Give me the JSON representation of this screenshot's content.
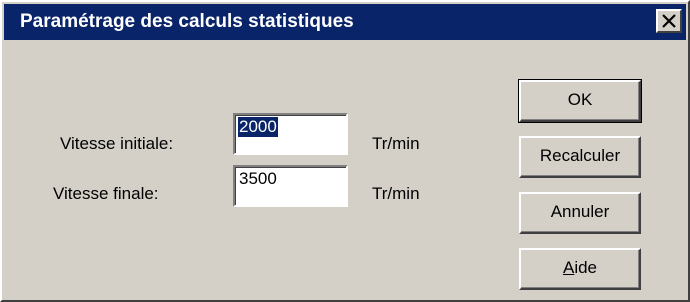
{
  "window": {
    "title": "Paramétrage des calculs statistiques",
    "close_icon": "close-icon"
  },
  "form": {
    "initial_speed_label": "Vitesse initiale:",
    "initial_speed_value": "2000",
    "initial_speed_unit": "Tr/min",
    "final_speed_label": "Vitesse finale:",
    "final_speed_value": "3500",
    "final_speed_unit": "Tr/min"
  },
  "buttons": {
    "ok": "OK",
    "recalculate": "Recalculer",
    "cancel": "Annuler",
    "help": "Aide"
  },
  "colors": {
    "titlebar": "#0a246a",
    "face": "#d4d0c8",
    "selection": "#0a246a"
  }
}
